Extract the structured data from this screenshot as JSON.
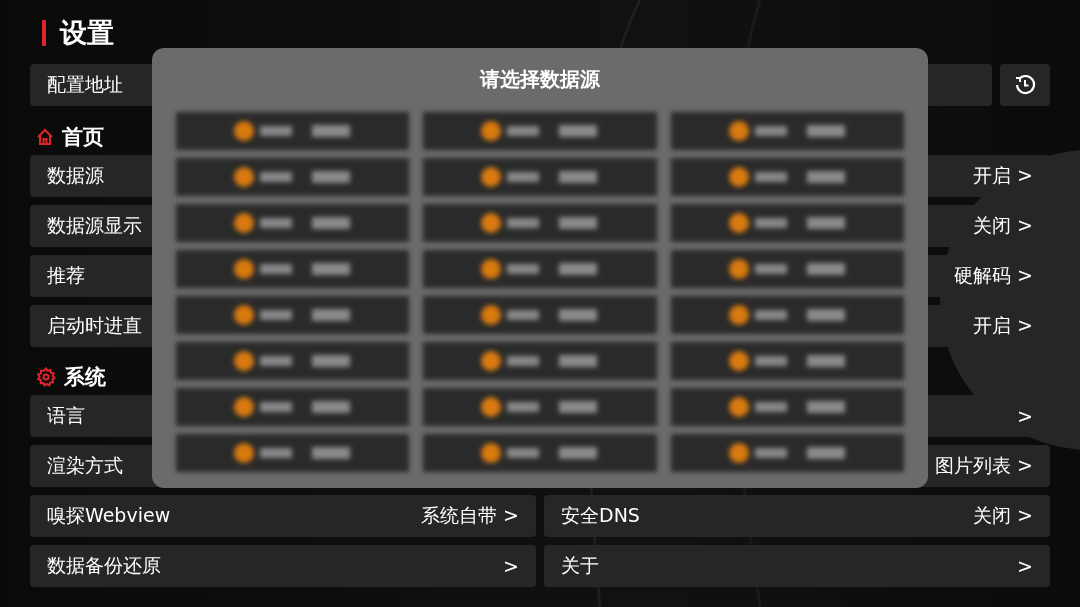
{
  "title": "设置",
  "config_row": {
    "label": "配置地址"
  },
  "sections": [
    {
      "title": "首页",
      "rows": [
        [
          {
            "label": "数据源"
          },
          {
            "value": "开启 >"
          }
        ],
        [
          {
            "label": "数据源显示"
          },
          {
            "value": "关闭 >"
          }
        ],
        [
          {
            "label": "推荐"
          },
          {
            "value": "硬解码 >"
          }
        ],
        [
          {
            "label": "启动时进直"
          },
          {
            "value": "开启 >"
          }
        ]
      ]
    },
    {
      "title": "系统",
      "rows": [
        [
          {
            "label": "语言"
          },
          {
            "value": ">"
          }
        ],
        [
          {
            "label": "渲染方式"
          },
          {
            "value": "图片列表 >"
          }
        ],
        [
          {
            "label": "嗅探Webview",
            "value": "系统自带 >"
          },
          {
            "label": "安全DNS",
            "value": "关闭 >"
          }
        ],
        [
          {
            "label": "数据备份还原",
            "value": ">"
          },
          {
            "label": "关于",
            "value": ">"
          }
        ]
      ]
    }
  ],
  "dialog": {
    "title": "请选择数据源"
  }
}
